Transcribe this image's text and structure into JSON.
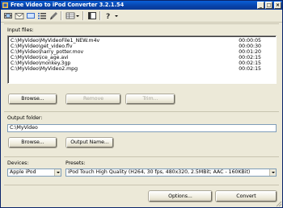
{
  "window": {
    "title": "Free Video to iPod Converter 3.2.1.54"
  },
  "toolbar": {
    "icons": [
      "film-icon",
      "mail-icon",
      "media-icon",
      "list-icon",
      "brush-icon",
      "grid-icon",
      "window-icon",
      "help-icon"
    ]
  },
  "input_files": {
    "label": "Input files:",
    "files": [
      {
        "name": "C:\\MyVideo\\MyVideoFile1_NEW.m4v",
        "duration": "00:00:05"
      },
      {
        "name": "C:\\MyVideo\\get_video.flv",
        "duration": "00:00:30"
      },
      {
        "name": "C:\\MyVideo\\harry_potter.mov",
        "duration": "00:01:20"
      },
      {
        "name": "C:\\MyVideo\\ice_age.avi",
        "duration": "00:02:15"
      },
      {
        "name": "C:\\MyVideo\\monkey.3gp",
        "duration": "00:02:15"
      },
      {
        "name": "C:\\MyVideo\\MyVideo2.mpg",
        "duration": "00:02:15"
      }
    ],
    "browse_label": "Browse...",
    "remove_label": "Remove",
    "trim_label": "Trim..."
  },
  "output_folder": {
    "label": "Output folder:",
    "value": "C:\\MyVideo",
    "browse_label": "Browse...",
    "output_name_label": "Output Name..."
  },
  "devices": {
    "label": "Devices:",
    "value": "Apple iPod"
  },
  "presets": {
    "label": "Presets:",
    "value": "iPod Touch High Quality (H264, 30 fps, 480x320, 2.5MBit; AAC - 160KBit)"
  },
  "footer": {
    "options_label": "Options...",
    "convert_label": "Convert"
  }
}
